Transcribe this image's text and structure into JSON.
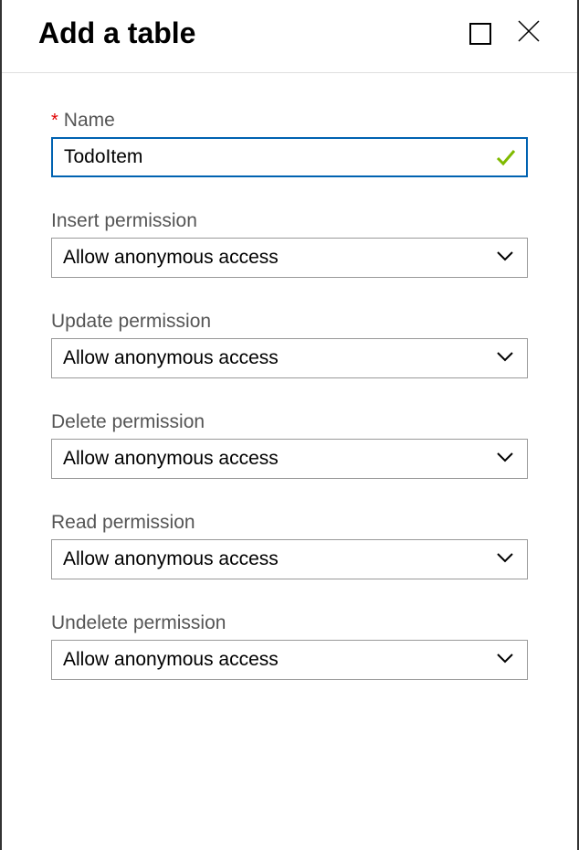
{
  "title": "Add a table",
  "name": {
    "label": "Name",
    "value": "TodoItem"
  },
  "permissions": [
    {
      "label": "Insert permission",
      "value": "Allow anonymous access"
    },
    {
      "label": "Update permission",
      "value": "Allow anonymous access"
    },
    {
      "label": "Delete permission",
      "value": "Allow anonymous access"
    },
    {
      "label": "Read permission",
      "value": "Allow anonymous access"
    },
    {
      "label": "Undelete permission",
      "value": "Allow anonymous access"
    }
  ]
}
